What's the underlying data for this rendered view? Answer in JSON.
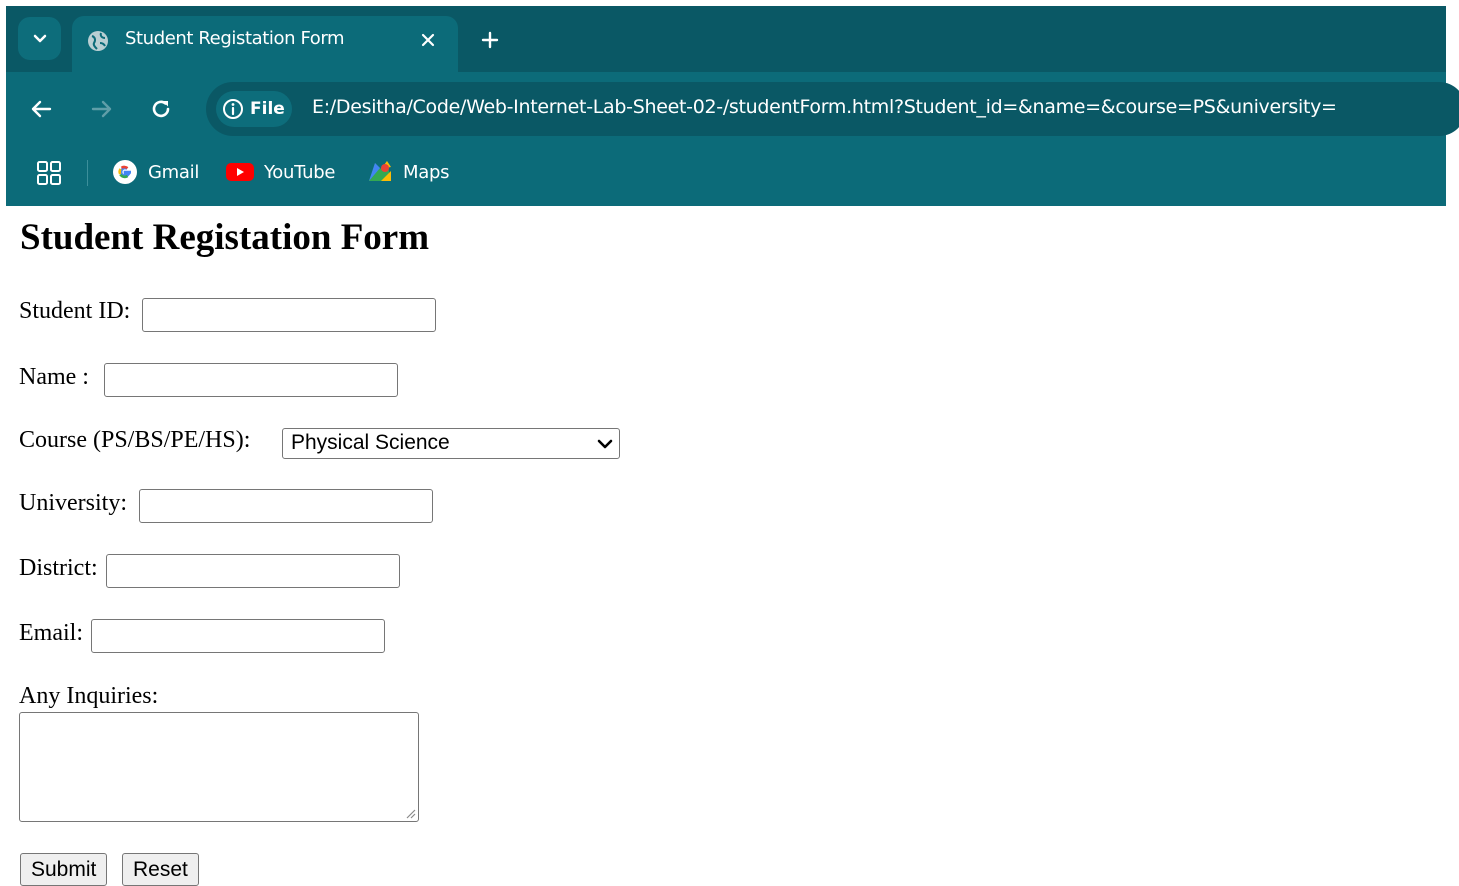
{
  "browser": {
    "tab": {
      "title": "Student Registation Form",
      "favicon": "globe-icon"
    },
    "address_bar": {
      "site_chip_label": "File",
      "url": "E:/Desitha/Code/Web-Internet-Lab-Sheet-02-/studentForm.html?Student_id=&name=&course=PS&university="
    },
    "bookmarks": [
      {
        "label": "Gmail",
        "icon": "google-icon"
      },
      {
        "label": "YouTube",
        "icon": "youtube-icon"
      },
      {
        "label": "Maps",
        "icon": "maps-icon"
      }
    ],
    "colors": {
      "toolbar": "#0c6b79",
      "tabstrip": "#0a5865"
    }
  },
  "form": {
    "title": "Student Registation Form",
    "fields": {
      "student_id": {
        "label": "Student ID:",
        "value": ""
      },
      "name": {
        "label": "Name :",
        "value": ""
      },
      "course": {
        "label": "Course (PS/BS/PE/HS):",
        "selected": "Physical Science"
      },
      "university": {
        "label": "University:",
        "value": ""
      },
      "district": {
        "label": "District:",
        "value": ""
      },
      "email": {
        "label": "Email:",
        "value": ""
      },
      "inquiries": {
        "label": "Any Inquiries:",
        "value": ""
      }
    },
    "buttons": {
      "submit": "Submit",
      "reset": "Reset"
    }
  }
}
